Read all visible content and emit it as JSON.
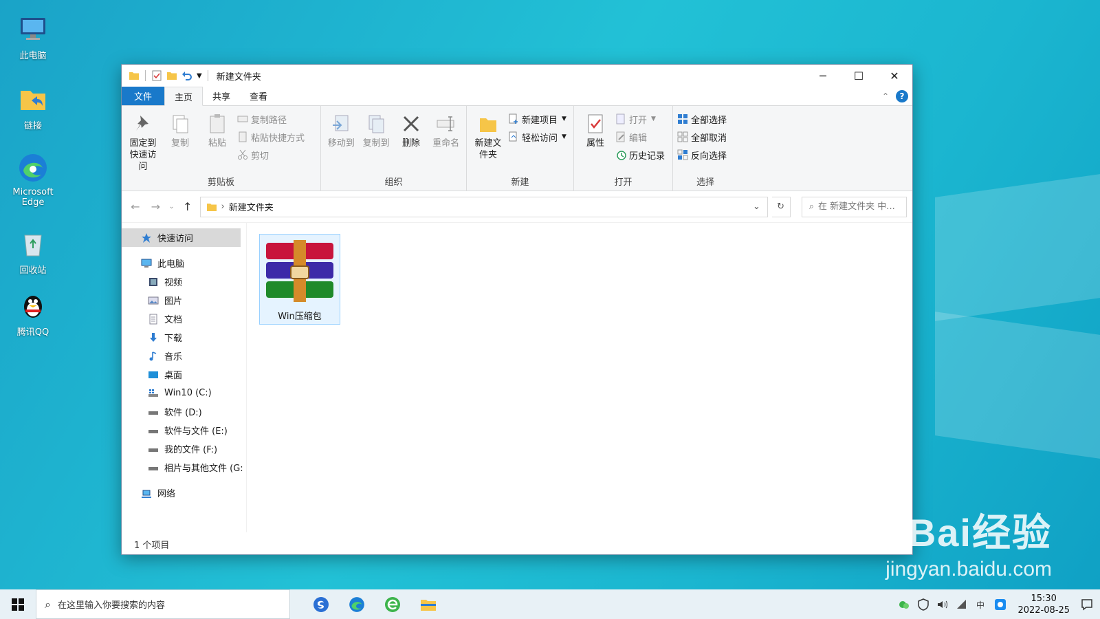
{
  "desktop": {
    "icons": [
      {
        "label": "此电脑",
        "icon": "computer-icon"
      },
      {
        "label": "链接",
        "icon": "folder-shortcut-icon"
      },
      {
        "label": "Microsoft Edge",
        "icon": "edge-icon"
      },
      {
        "label": "回收站",
        "icon": "recycle-bin-icon"
      },
      {
        "label": "腾讯QQ",
        "icon": "qq-icon"
      }
    ]
  },
  "window": {
    "title": "新建文件夹",
    "controls": {
      "minimize": "─",
      "maximize": "☐",
      "close": "✕"
    }
  },
  "ribbon": {
    "tabs": [
      "文件",
      "主页",
      "共享",
      "查看"
    ],
    "active_tab": "主页",
    "groups": {
      "clipboard": {
        "label": "剪贴板",
        "pin": "固定到快速访问",
        "copy": "复制",
        "paste": "粘贴",
        "copy_path": "复制路径",
        "paste_shortcut": "粘贴快捷方式",
        "cut": "剪切"
      },
      "organize": {
        "label": "组织",
        "move_to": "移动到",
        "copy_to": "复制到",
        "delete": "删除",
        "rename": "重命名"
      },
      "new": {
        "label": "新建",
        "new_folder": "新建文件夹",
        "new_item": "新建项目",
        "easy_access": "轻松访问"
      },
      "open": {
        "label": "打开",
        "properties": "属性",
        "open": "打开",
        "edit": "编辑",
        "history": "历史记录"
      },
      "select": {
        "label": "选择",
        "select_all": "全部选择",
        "select_none": "全部取消",
        "invert": "反向选择"
      }
    }
  },
  "address": {
    "path": "新建文件夹",
    "search_placeholder": "在 新建文件夹 中..."
  },
  "navpane": {
    "quick_access": "快速访问",
    "this_pc": "此电脑",
    "items": [
      {
        "label": "视频",
        "icon": "video-folder-icon"
      },
      {
        "label": "图片",
        "icon": "pictures-folder-icon"
      },
      {
        "label": "文档",
        "icon": "documents-folder-icon"
      },
      {
        "label": "下载",
        "icon": "download-folder-icon"
      },
      {
        "label": "音乐",
        "icon": "music-folder-icon"
      },
      {
        "label": "桌面",
        "icon": "desktop-folder-icon"
      },
      {
        "label": "Win10 (C:)",
        "icon": "system-drive-icon"
      },
      {
        "label": "软件 (D:)",
        "icon": "drive-icon"
      },
      {
        "label": "软件与文件 (E:)",
        "icon": "drive-icon"
      },
      {
        "label": "我的文件 (F:)",
        "icon": "drive-icon"
      },
      {
        "label": "相片与其他文件 (G:",
        "icon": "drive-icon"
      }
    ],
    "network": "网络"
  },
  "content": {
    "files": [
      {
        "name": "Win压缩包",
        "icon": "winrar-archive-icon"
      }
    ]
  },
  "status": {
    "item_count": "1 个项目"
  },
  "taskbar": {
    "search_placeholder": "在这里输入你要搜索的内容",
    "time": "15:30",
    "date": "2022-08-25"
  },
  "watermark": {
    "brand": "Bai经验",
    "url": "jingyan.baidu.com"
  },
  "colors": {
    "accent": "#1979ca",
    "ribbon_bg": "#f5f6f7",
    "selection_bg": "#e5f3ff"
  }
}
